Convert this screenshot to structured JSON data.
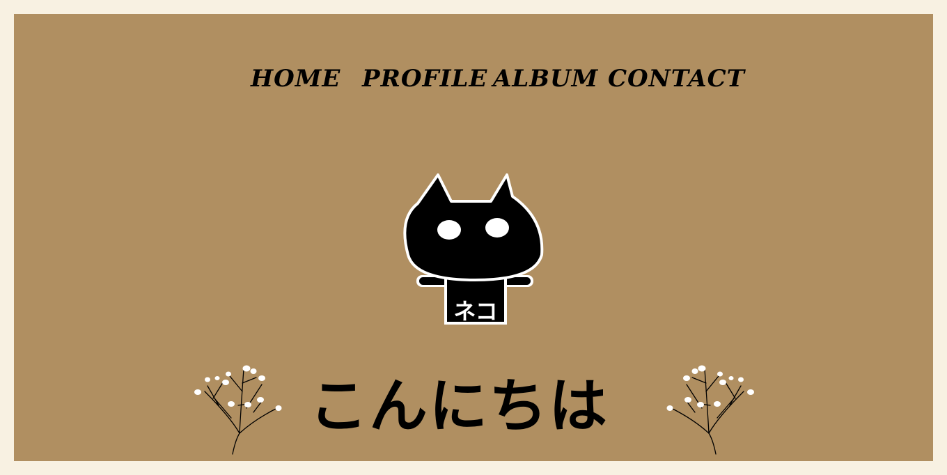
{
  "nav": {
    "home": "HOME",
    "profile": "PROFILE",
    "album": "ALBUM",
    "contact": "CONTACT"
  },
  "hero": {
    "shirt_text": "ネコ",
    "greeting": "こんにちは"
  },
  "colors": {
    "page_background": "#f8f1e2",
    "panel_background": "#b08f61",
    "text": "#000000",
    "flower": "#ffffff"
  },
  "icons": [
    "black-cat-icon",
    "baby-breath-flower-icon"
  ]
}
